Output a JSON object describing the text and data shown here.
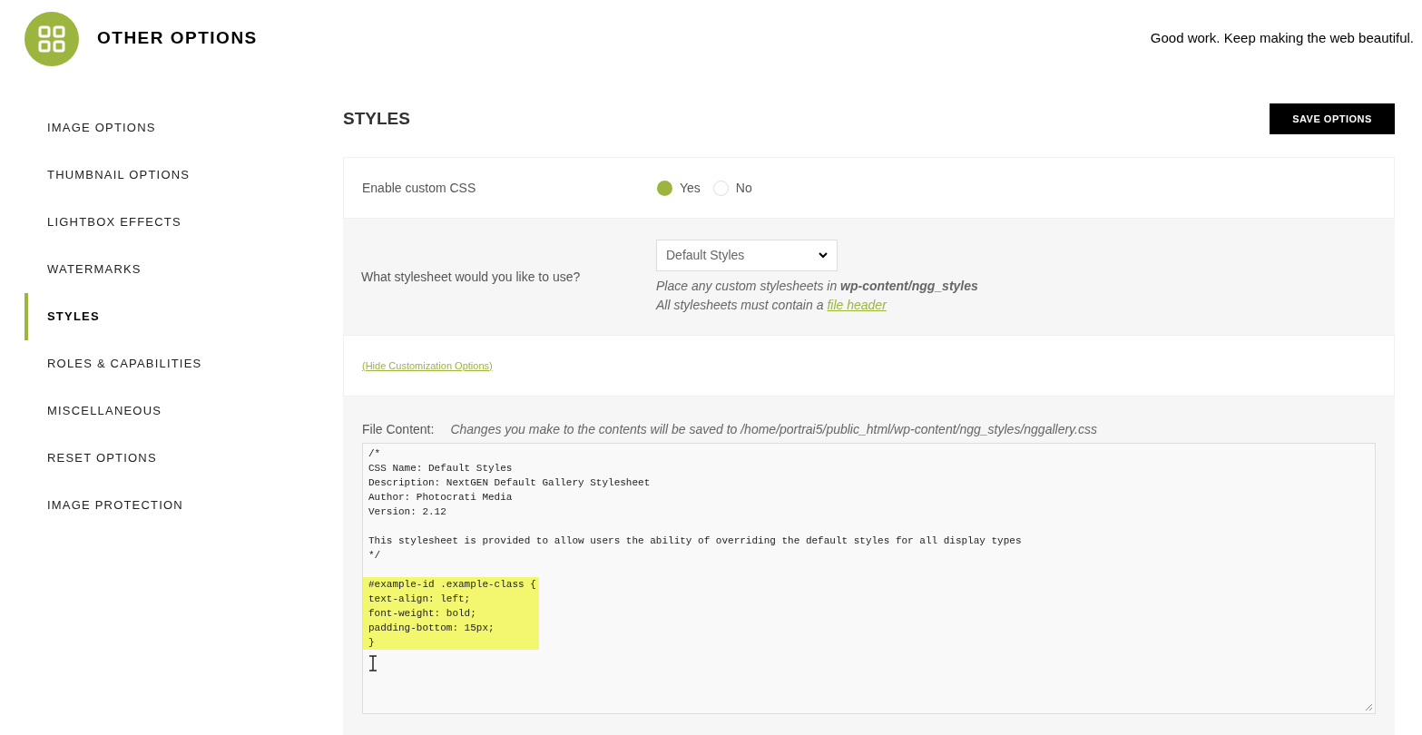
{
  "header": {
    "title": "OTHER OPTIONS",
    "tagline": "Good work. Keep making the web beautiful."
  },
  "sidebar": {
    "items": [
      {
        "label": "IMAGE OPTIONS",
        "selected": false
      },
      {
        "label": "THUMBNAIL OPTIONS",
        "selected": false
      },
      {
        "label": "LIGHTBOX EFFECTS",
        "selected": false
      },
      {
        "label": "WATERMARKS",
        "selected": false
      },
      {
        "label": "STYLES",
        "selected": true
      },
      {
        "label": "ROLES & CAPABILITIES",
        "selected": false
      },
      {
        "label": "MISCELLANEOUS",
        "selected": false
      },
      {
        "label": "RESET OPTIONS",
        "selected": false
      },
      {
        "label": "IMAGE PROTECTION",
        "selected": false
      }
    ]
  },
  "section": {
    "title": "STYLES",
    "save_button": "SAVE OPTIONS"
  },
  "enable_css": {
    "label": "Enable custom CSS",
    "options": [
      {
        "label": "Yes",
        "selected": true
      },
      {
        "label": "No",
        "selected": false
      }
    ]
  },
  "stylesheet": {
    "label": "What stylesheet would you like to use?",
    "value": "Default Styles",
    "hint_1": "Place any custom stylesheets in **wp-content/ngg_styles**",
    "hint_2": {
      "text": "All stylesheets must contain a",
      "link": "file header"
    }
  },
  "toggle_link": "(Hide Customization Options)",
  "file_content": {
    "label": "File Content:",
    "note": "Changes you make to the contents will be saved to /home/portrai5/public_html/wp-content/ngg_styles/nggallery.css",
    "text": "/*\nCSS Name: Default Styles\nDescription: NextGEN Default Gallery Stylesheet\nAuthor: Photocrati Media\nVersion: 2.12\n\nThis stylesheet is provided to allow users the ability of overriding the default styles for all display types\n*/",
    "selected_text": "#example-id .example-class {\ntext-align: left;\nfont-weight: bold;\npadding-bottom: 15px;\n}"
  }
}
